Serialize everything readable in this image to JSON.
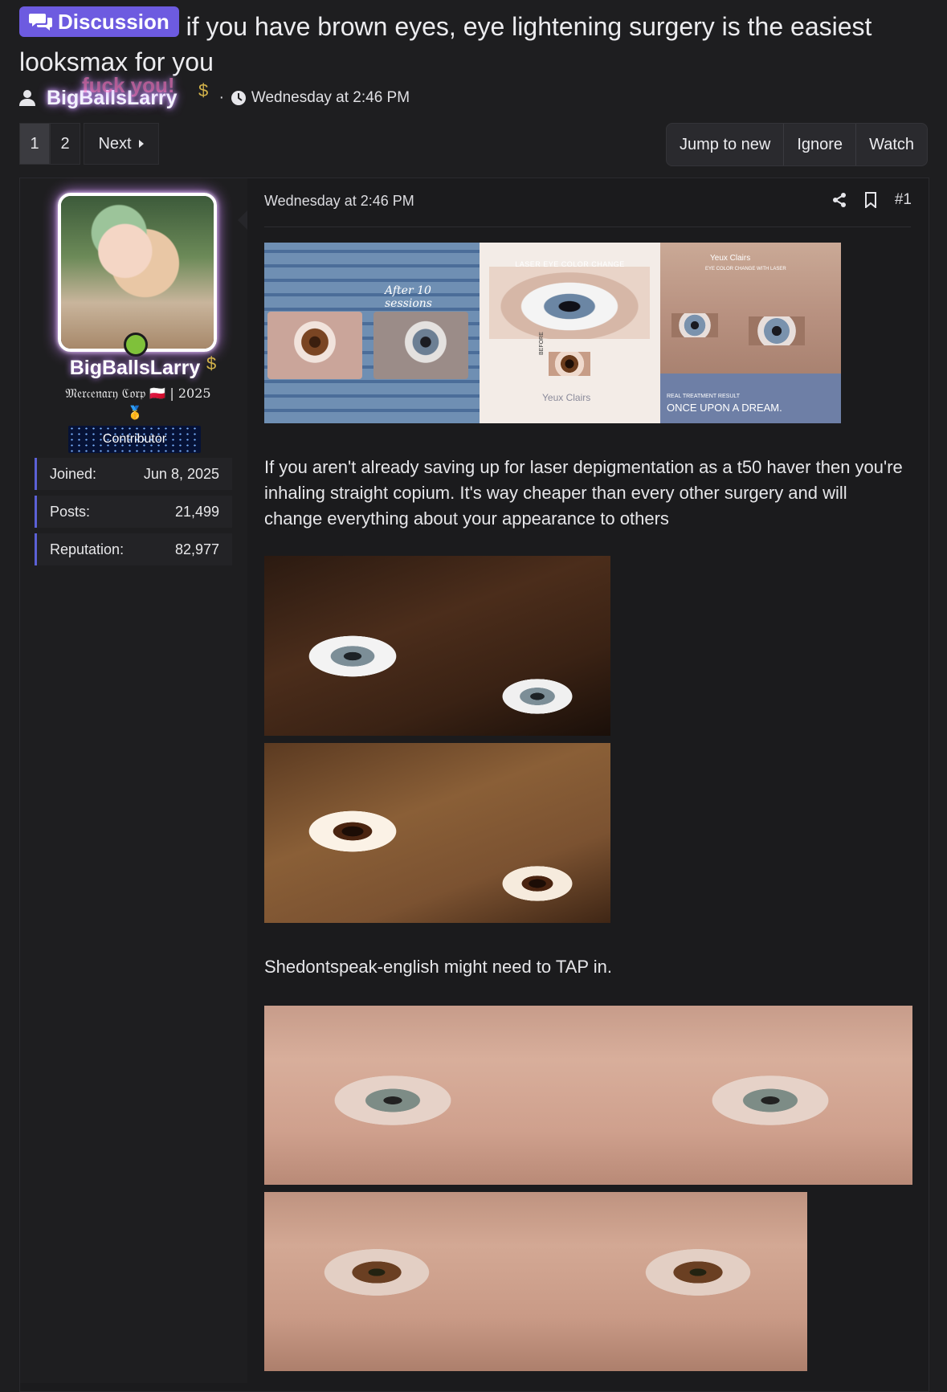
{
  "thread": {
    "prefix_label": "Discussion",
    "title": "if you have brown eyes, eye lightening surgery is the easiest looksmax for you",
    "author": "BigBallsLarry",
    "author_overlay": "fuck you!",
    "date": "Wednesday at 2:46 PM"
  },
  "pagination": {
    "pages": [
      "1",
      "2"
    ],
    "current_page": "1",
    "next_label": "Next"
  },
  "thread_actions": {
    "jump_label": "Jump to new",
    "ignore_label": "Ignore",
    "watch_label": "Watch"
  },
  "user": {
    "name": "BigBallsLarry",
    "name_overlay": "fuck you!",
    "title": "𝔐𝔢𝔯𝔠𝔢𝔫𝔞𝔯𝔶 ℭ𝔬𝔯𝔭 🇵🇱 | 2025",
    "medal": "🥇",
    "banner": "Contributor",
    "dollar_sign": "$",
    "stats": [
      {
        "label": "Joined:",
        "value": "Jun 8, 2025"
      },
      {
        "label": "Posts:",
        "value": "21,499"
      },
      {
        "label": "Reputation:",
        "value": "82,977"
      }
    ]
  },
  "post": {
    "date": "Wednesday at 2:46 PM",
    "number": "#1",
    "image_captions": {
      "after_sessions": "After 10 sessions",
      "laser_title": "LASER EYE COLOR CHANGE",
      "before_label": "BEFORE",
      "brand": "Yeux Clairs",
      "eye_color_change": "EYE COLOR CHANGE WITH LASER",
      "real_result": "REAL TREATMENT RESULT",
      "dream": "ONCE UPON A DREAM."
    },
    "paragraph1": "If you aren't already saving up for laser depigmentation as a t50 haver then you're inhaling straight copium. It's way cheaper than every other surgery and will change everything about your appearance to others",
    "paragraph2": "Shedontspeak-english might need to TAP in."
  },
  "icons": {
    "prefix": "chat-bubbles-icon",
    "user": "user-icon",
    "clock": "clock-icon",
    "share": "share-icon",
    "bookmark": "bookmark-icon",
    "next_arrow": "caret-right-icon"
  },
  "colors": {
    "background": "#1e1e20",
    "prefix": "#6d5be0",
    "stat_accent": "#5b61d6",
    "online": "#7fc13a",
    "dollar": "#d2b24a"
  }
}
